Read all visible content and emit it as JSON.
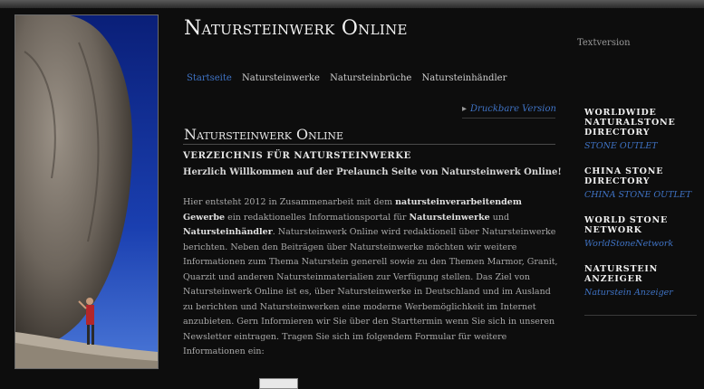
{
  "header": {
    "site_title": "Natursteinwerk Online",
    "textversion": "Textversion"
  },
  "nav": {
    "items": [
      "Startseite",
      "Natursteinwerke",
      "Natursteinbrüche",
      "Natursteinhändler"
    ],
    "active": "Startseite"
  },
  "content": {
    "print_link": "Druckbare Version",
    "title": "Natursteinwerk Online",
    "subheading": "VERZEICHNIS FÜR NATURSTEINWERKE",
    "welcome": "Herzlich Willkommen auf der Prelaunch Seite von Natursteinwerk Online!",
    "paragraph": [
      {
        "t": "Hier entsteht 2012 in Zusammenarbeit mit dem "
      },
      {
        "t": "natursteinverarbeitendem Gewerbe",
        "b": true
      },
      {
        "t": " ein redaktionelles Informationsportal für "
      },
      {
        "t": "Natursteinwerke",
        "b": true
      },
      {
        "t": " und "
      },
      {
        "t": "Natursteinhändler",
        "b": true
      },
      {
        "t": ". Natursteinwerk Online wird redaktionell über Natursteinwerke berichten. Neben den Beiträgen über Natursteinwerke möchten wir weitere Informationen zum Thema Naturstein generell sowie zu den Themen Marmor, Granit, Quarzit und anderen Natursteinmaterialien zur Verfügung stellen. Das Ziel von Natursteinwerk Online ist es, über Natursteinwerke in Deutschland und im Ausland zu berichten und Natursteinwerken eine moderne Werbemöglichkeit im Internet anzubieten. Gern Informieren wir Sie über den Starttermin wenn Sie sich in unseren Newsletter eintragen. Tragen Sie sich im folgendem Formular für weitere Informationen ein:"
      }
    ]
  },
  "sidebar": {
    "blocks": [
      {
        "heading": "Worldwide Naturalstone Directory",
        "link": "STONE OUTLET"
      },
      {
        "heading": "China Stone Directory",
        "link": "CHINA STONE OUTLET"
      },
      {
        "heading": "World Stone Network",
        "link": "WorldStoneNetwork"
      },
      {
        "heading": "Naturstein Anzeiger",
        "link": "Naturstein Anzeiger"
      }
    ]
  }
}
